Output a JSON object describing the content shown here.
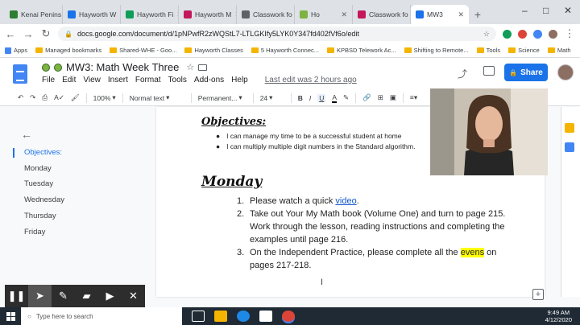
{
  "browser": {
    "tabs": [
      {
        "label": "Kenai Penins",
        "color": "#2e7d32"
      },
      {
        "label": "Hayworth W",
        "color": "#1a73e8"
      },
      {
        "label": "Hayworth Fi",
        "color": "#0f9d58"
      },
      {
        "label": "Hayworth M",
        "color": "#c2185b"
      },
      {
        "label": "Classwork fo",
        "color": "#5f6368"
      },
      {
        "label": "Ho",
        "color": "#7cb342"
      },
      {
        "label": "Classwork fo",
        "color": "#c2185b"
      },
      {
        "label": "MW3",
        "color": "#1a73e8",
        "active": true
      }
    ],
    "new_tab": "+",
    "window_controls": [
      "–",
      "□",
      "✕"
    ],
    "url": "docs.google.com/document/d/1pNPwfR2zWQStL7-LTLGKIfy5LYK0Y347fd402fVf6o/edit",
    "bookmarks": [
      "Apps",
      "Managed bookmarks",
      "Shared-WHE - Goo...",
      "Hayworth Classes",
      "5 Hayworth Connec...",
      "KPBSD Telework Ac...",
      "Shifting to Remote...",
      "Tools",
      "Science",
      "Math"
    ]
  },
  "docs": {
    "title": "MW3: Math Week Three",
    "menu": [
      "File",
      "Edit",
      "View",
      "Insert",
      "Format",
      "Tools",
      "Add-ons",
      "Help"
    ],
    "last_edit": "Last edit was 2 hours ago",
    "share_label": "Share",
    "toolbar": {
      "zoom": "100%",
      "style": "Normal text",
      "font": "Permanent...",
      "size": "24"
    }
  },
  "outline": {
    "items": [
      {
        "label": "Objectives:",
        "selected": true
      },
      {
        "label": "Monday"
      },
      {
        "label": "Tuesday"
      },
      {
        "label": "Wednesday"
      },
      {
        "label": "Thursday"
      },
      {
        "label": "Friday"
      }
    ]
  },
  "doc": {
    "objectives_heading": "Objectives:",
    "objectives": [
      "I can manage my time to be a successful student at home",
      "I can multiply multiple digit numbers in the Standard algorithm."
    ],
    "monday_heading": "Monday",
    "steps": [
      {
        "num": "1.",
        "before": "Please watch a quick ",
        "link": "video",
        "after": "."
      },
      {
        "num": "2.",
        "text": "Take out Your My Math book (Volume One) and turn to page 215. Work through the lesson, reading instructions and completing the examples until page 216."
      },
      {
        "num": "3.",
        "before": "On the Independent Practice, please complete all the ",
        "highlight": "evens",
        "after": " on pages 217-218."
      }
    ]
  },
  "taskbar": {
    "search_placeholder": "Type here to search",
    "time": "9:49 AM",
    "date": "4/12/2020"
  }
}
